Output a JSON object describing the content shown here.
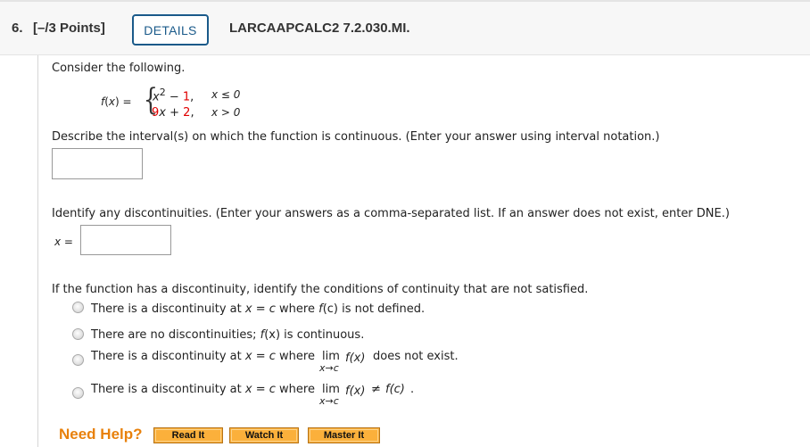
{
  "header": {
    "question_number": "6.",
    "points": "[–/3 Points]",
    "details_label": "DETAILS",
    "question_code": "LARCAAPCALC2 7.2.030.MI."
  },
  "problem": {
    "intro": "Consider the following.",
    "function_name": "f(x) = ",
    "piece1": {
      "expr_base": "x",
      "expr_exp": "2",
      "expr_op": " − ",
      "expr_const": "1",
      "comma": ",",
      "condition": "x ≤ 0"
    },
    "piece2": {
      "coef": "9",
      "var": "x",
      "op": " + ",
      "const": "2",
      "comma": ",",
      "condition": "x > 0"
    }
  },
  "part1": {
    "prompt": "Describe the interval(s) on which the function is continuous. (Enter your answer using interval notation.)",
    "answer_value": ""
  },
  "part2": {
    "prompt": "Identify any discontinuities. (Enter your answers as a comma-separated list. If an answer does not exist, enter DNE.)",
    "label": "x =",
    "answer_value": ""
  },
  "part3": {
    "prompt": "If the function has a discontinuity, identify the conditions of continuity that are not satisfied.",
    "options": [
      {
        "pre": "There is a discontinuity at ",
        "var1": "x",
        "mid": " = ",
        "var2": "c",
        "post": " where ",
        "fn": "f",
        "arg": "(c)",
        "tail": " is not defined."
      },
      {
        "pre": "There are no discontinuities; ",
        "fn": "f",
        "arg": "(x)",
        "tail": " is continuous."
      },
      {
        "pre": "There is a discontinuity at ",
        "var1": "x",
        "mid": " = ",
        "var2": "c",
        "post": " where ",
        "lim": "lim",
        "lim_sub": "x→c",
        "fx": "f(x)",
        "tail": " does not exist."
      },
      {
        "pre": "There is a discontinuity at ",
        "var1": "x",
        "mid": " = ",
        "var2": "c",
        "post": " where ",
        "lim": "lim",
        "lim_sub": "x→c",
        "fx": "f(x)",
        "neq": " ≠ ",
        "fc": "f(c)",
        "tail": "."
      }
    ]
  },
  "help": {
    "label": "Need Help?",
    "buttons": [
      "Read It",
      "Watch It",
      "Master It"
    ]
  },
  "colors": {
    "accent_blue": "#1a5a8a",
    "highlight_red": "#e00000",
    "help_orange": "#e8810c",
    "help_button": "#fbb03b"
  }
}
